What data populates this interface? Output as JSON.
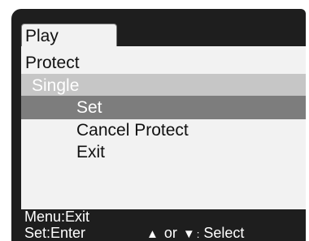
{
  "tab": {
    "label": "Play"
  },
  "menu": {
    "title": "Protect",
    "submenu": "Single",
    "options": [
      "Set",
      "Cancel Protect",
      "Exit"
    ]
  },
  "footer": {
    "menu_hint": "Menu:Exit",
    "set_hint": "Set:Enter",
    "nav": {
      "up_icon": "triangle-up-icon",
      "separator": "or",
      "down_icon": "triangle-down-icon",
      "colon": ":",
      "action": "Select"
    }
  },
  "colors": {
    "panel": "#f2f2f2",
    "selected_row": "#7d7d7d",
    "submenu_row": "#c6c6c6",
    "screen": "#1e1e1e"
  }
}
